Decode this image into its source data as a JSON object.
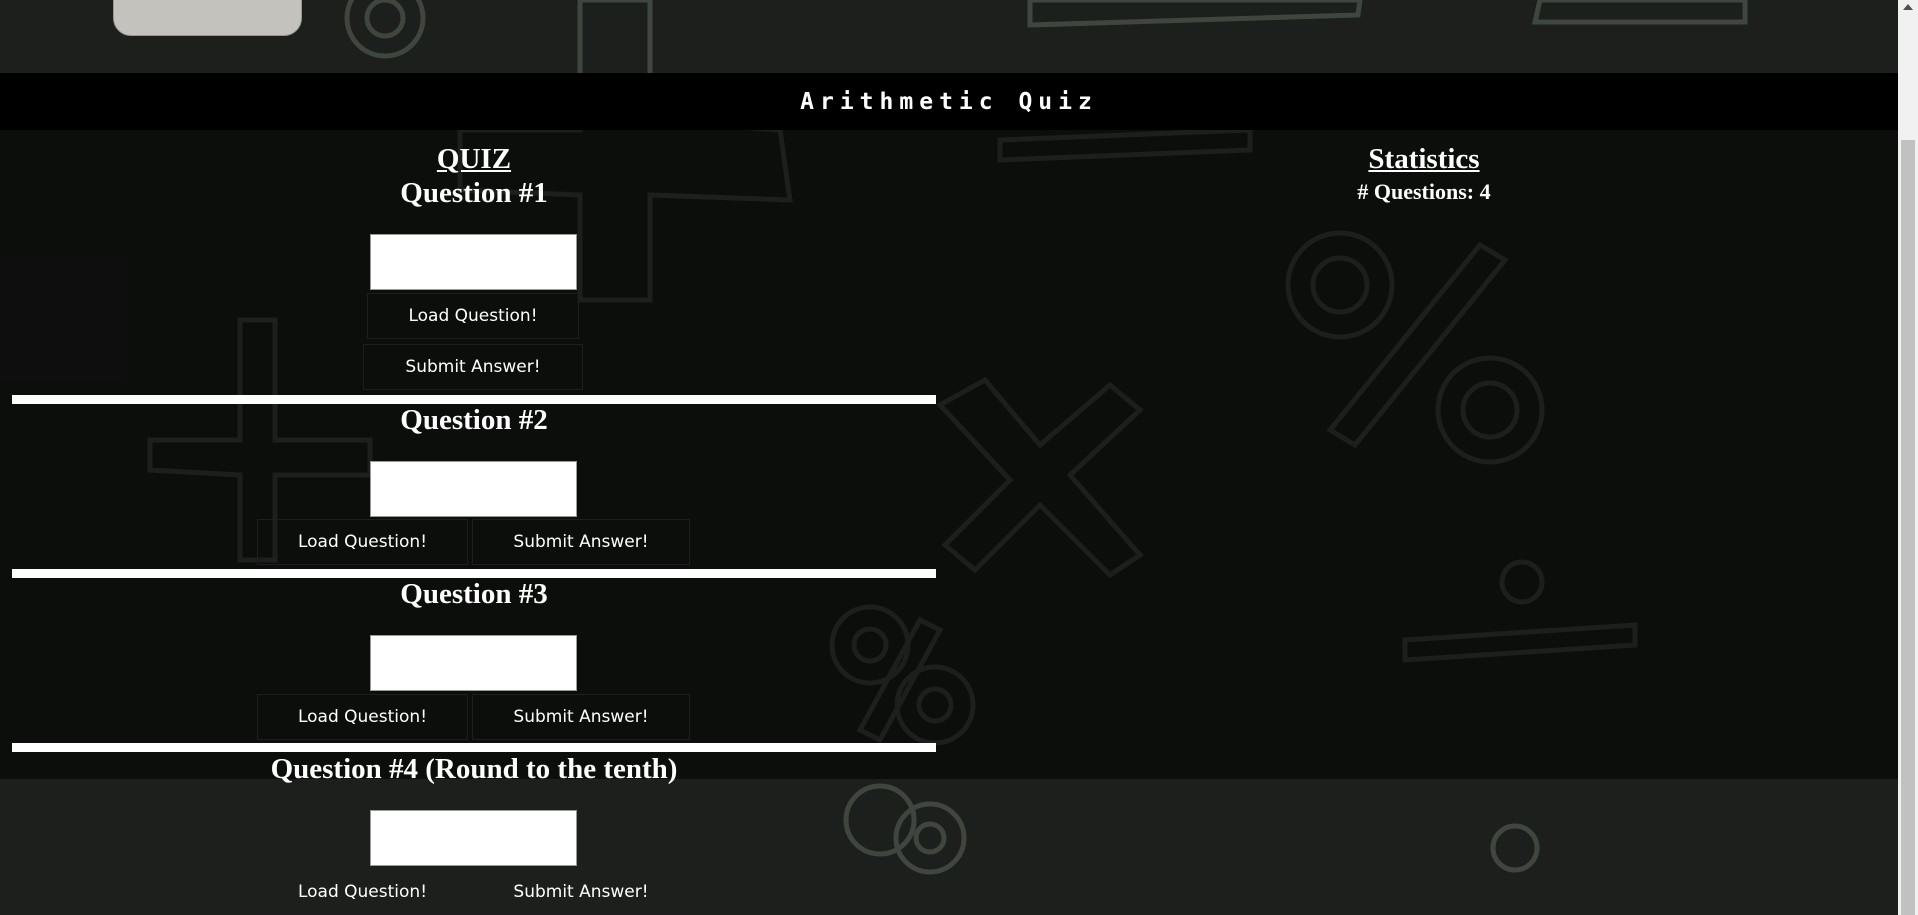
{
  "header": {
    "title": "Arithmetic Quiz"
  },
  "quiz": {
    "heading": "QUIZ",
    "questions": [
      {
        "title": "Question #1",
        "load_label": "Load Question!",
        "submit_label": "Submit Answer!"
      },
      {
        "title": "Question #2",
        "load_label": "Load Question!",
        "submit_label": "Submit Answer!"
      },
      {
        "title": "Question #3",
        "load_label": "Load Question!",
        "submit_label": "Submit Answer!"
      },
      {
        "title": "Question #4 (Round to the tenth)",
        "load_label": "Load Question!",
        "submit_label": "Submit Answer!"
      }
    ]
  },
  "stats": {
    "heading": "Statistics",
    "count_label": "# Questions: 4"
  },
  "colors": {
    "header_bg": "#000000",
    "page_bg": "#1c1f1c",
    "chalk": "#8c948c",
    "divider": "#ffffff"
  },
  "icons": {
    "background_symbols": [
      "plus-icon",
      "percent-icon",
      "times-icon",
      "divide-icon",
      "equals-icon"
    ]
  }
}
